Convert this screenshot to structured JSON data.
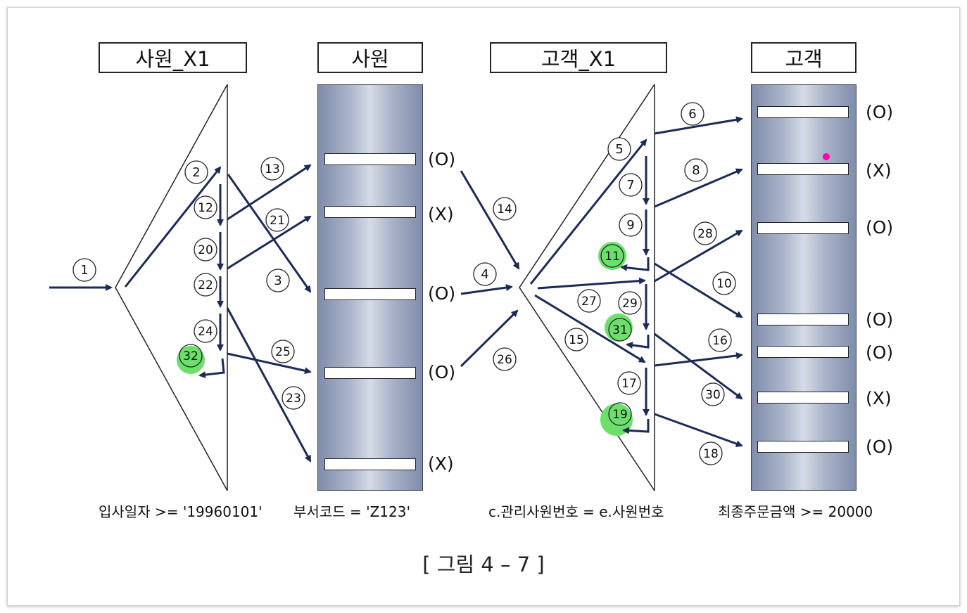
{
  "titles": {
    "emp_index": "사원_X1",
    "emp_table": "사원",
    "cust_index": "고객_X1",
    "cust_table": "고객"
  },
  "emp_rows": [
    "(O)",
    "(X)",
    "(O)",
    "(O)",
    "(X)"
  ],
  "cust_rows": [
    "(O)",
    "(X)",
    "(O)",
    "(O)",
    "(O)",
    "(X)",
    "(O)"
  ],
  "conditions": {
    "emp_index": "입사일자 >= '19960101'",
    "emp_table": "부서코드 = 'Z123'",
    "cust_index": "c.관리사원번호 = e.사원번호",
    "cust_table": "최종주문금액 >= 20000"
  },
  "step_labels": [
    "1",
    "2",
    "3",
    "4",
    "5",
    "6",
    "7",
    "8",
    "9",
    "10",
    "11",
    "12",
    "13",
    "14",
    "15",
    "16",
    "17",
    "18",
    "19",
    "20",
    "21",
    "22",
    "23",
    "24",
    "25",
    "26",
    "27",
    "28",
    "29",
    "30",
    "31",
    "32"
  ],
  "highlighted_steps": [
    "11",
    "19",
    "31",
    "32"
  ],
  "caption": "[ 그림 4 – 7 ]",
  "colors": {
    "arrow": "#1c2b55",
    "highlight": "#6be06b",
    "marker": "#ff00aa"
  }
}
